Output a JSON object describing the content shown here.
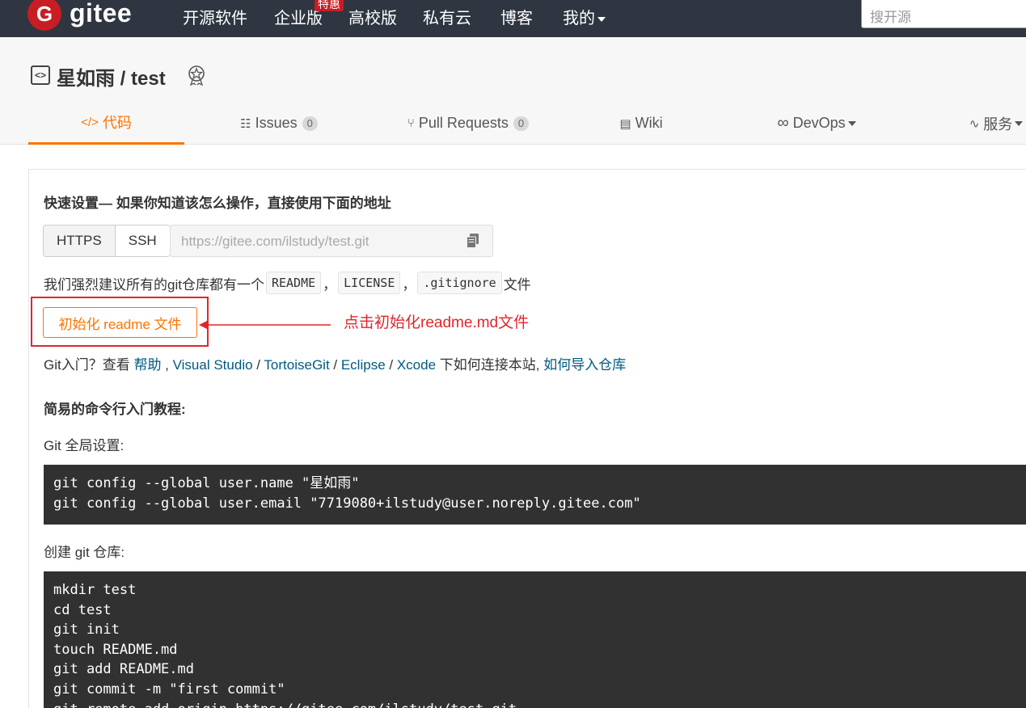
{
  "navbar": {
    "logo_text": "gitee",
    "logo_mark": "G",
    "items": [
      "开源软件",
      "企业版",
      "高校版",
      "私有云",
      "博客",
      "我的"
    ],
    "badge": "特惠",
    "search_placeholder": "搜开源"
  },
  "repo": {
    "title": "星如雨 / test",
    "tabs": [
      {
        "label": "代码",
        "icon": "code-icon"
      },
      {
        "label": "Issues",
        "count": "0",
        "icon": "issues-icon"
      },
      {
        "label": "Pull Requests",
        "count": "0",
        "icon": "pull-request-icon"
      },
      {
        "label": "Wiki",
        "icon": "wiki-icon"
      },
      {
        "label": "DevOps",
        "icon": "infinity-icon"
      },
      {
        "label": "服务",
        "icon": "pulse-icon"
      }
    ]
  },
  "quick": {
    "heading": "快速设置— 如果你知道该怎么操作，直接使用下面的地址",
    "https": "HTTPS",
    "ssh": "SSH",
    "url": "https://gitee.com/ilstudy/test.git",
    "recommend_prefix": "我们强烈建议所有的git仓库都有一个",
    "chips": [
      "README",
      "LICENSE",
      ".gitignore"
    ],
    "recommend_suffix": "文件",
    "sep": "，",
    "init_button": "初始化 readme 文件",
    "annotation": "点击初始化readme.md文件",
    "help": {
      "prefix": "Git入门？查看 ",
      "links": [
        "帮助",
        "Visual Studio",
        "TortoiseGit",
        "Eclipse",
        "Xcode"
      ],
      "seps": [
        " , ",
        " / ",
        " / ",
        " / "
      ],
      "middle": " 下如何连接本站, ",
      "last_link": "如何导入仓库"
    }
  },
  "tutorial": {
    "heading": "简易的命令行入门教程:",
    "global_label": "Git 全局设置:",
    "global_code": "git config --global user.name \"星如雨\"\ngit config --global user.email \"7719080+ilstudy@user.noreply.gitee.com\"",
    "create_label": "创建 git 仓库:",
    "create_code": "mkdir test\ncd test\ngit init\ntouch README.md\ngit add README.md\ngit commit -m \"first commit\"\ngit remote add origin https://gitee.com/ilstudy/test.git"
  }
}
